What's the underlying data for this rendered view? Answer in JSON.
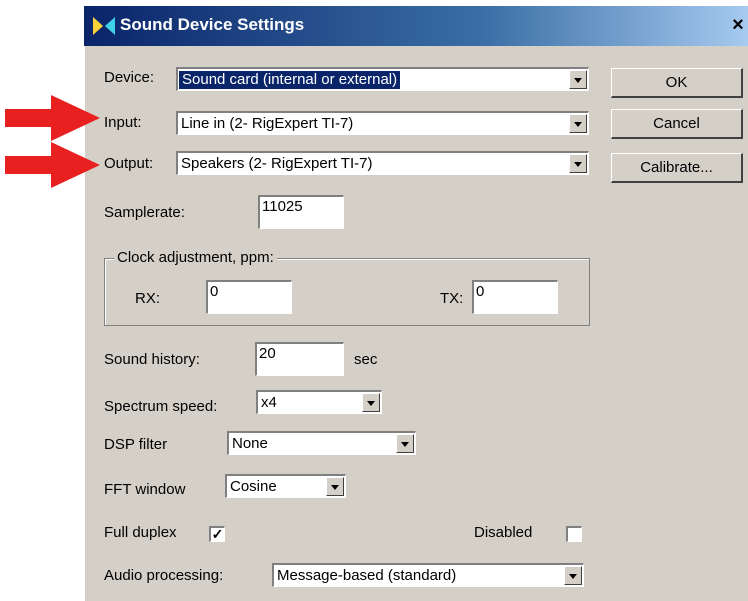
{
  "window": {
    "title": "Sound Device Settings",
    "close_glyph": "×"
  },
  "labels": {
    "device": "Device:",
    "input": "Input:",
    "output": "Output:",
    "samplerate": "Samplerate:",
    "clock_group": "Clock adjustment, ppm:",
    "rx": "RX:",
    "tx": "TX:",
    "sound_history": "Sound history:",
    "sec": "sec",
    "spectrum_speed": "Spectrum speed:",
    "dsp_filter": "DSP filter",
    "fft_window": "FFT window",
    "full_duplex": "Full duplex",
    "disabled": "Disabled",
    "audio_processing": "Audio processing:"
  },
  "values": {
    "device": "Sound card (internal or external)",
    "input": "Line in (2- RigExpert TI-7)",
    "output": "Speakers (2- RigExpert TI-7)",
    "samplerate": "11025",
    "rx": "0",
    "tx": "0",
    "sound_history": "20",
    "spectrum_speed": "x4",
    "dsp_filter": "None",
    "fft_window": "Cosine",
    "audio_processing": "Message-based (standard)",
    "full_duplex_checked": true,
    "disabled_checked": false
  },
  "buttons": {
    "ok": "OK",
    "cancel": "Cancel",
    "calibrate": "Calibrate..."
  },
  "colors": {
    "arrow": "#e8201f",
    "dialog_bg": "#d4d0c8",
    "title_bar": "#0a246a"
  }
}
